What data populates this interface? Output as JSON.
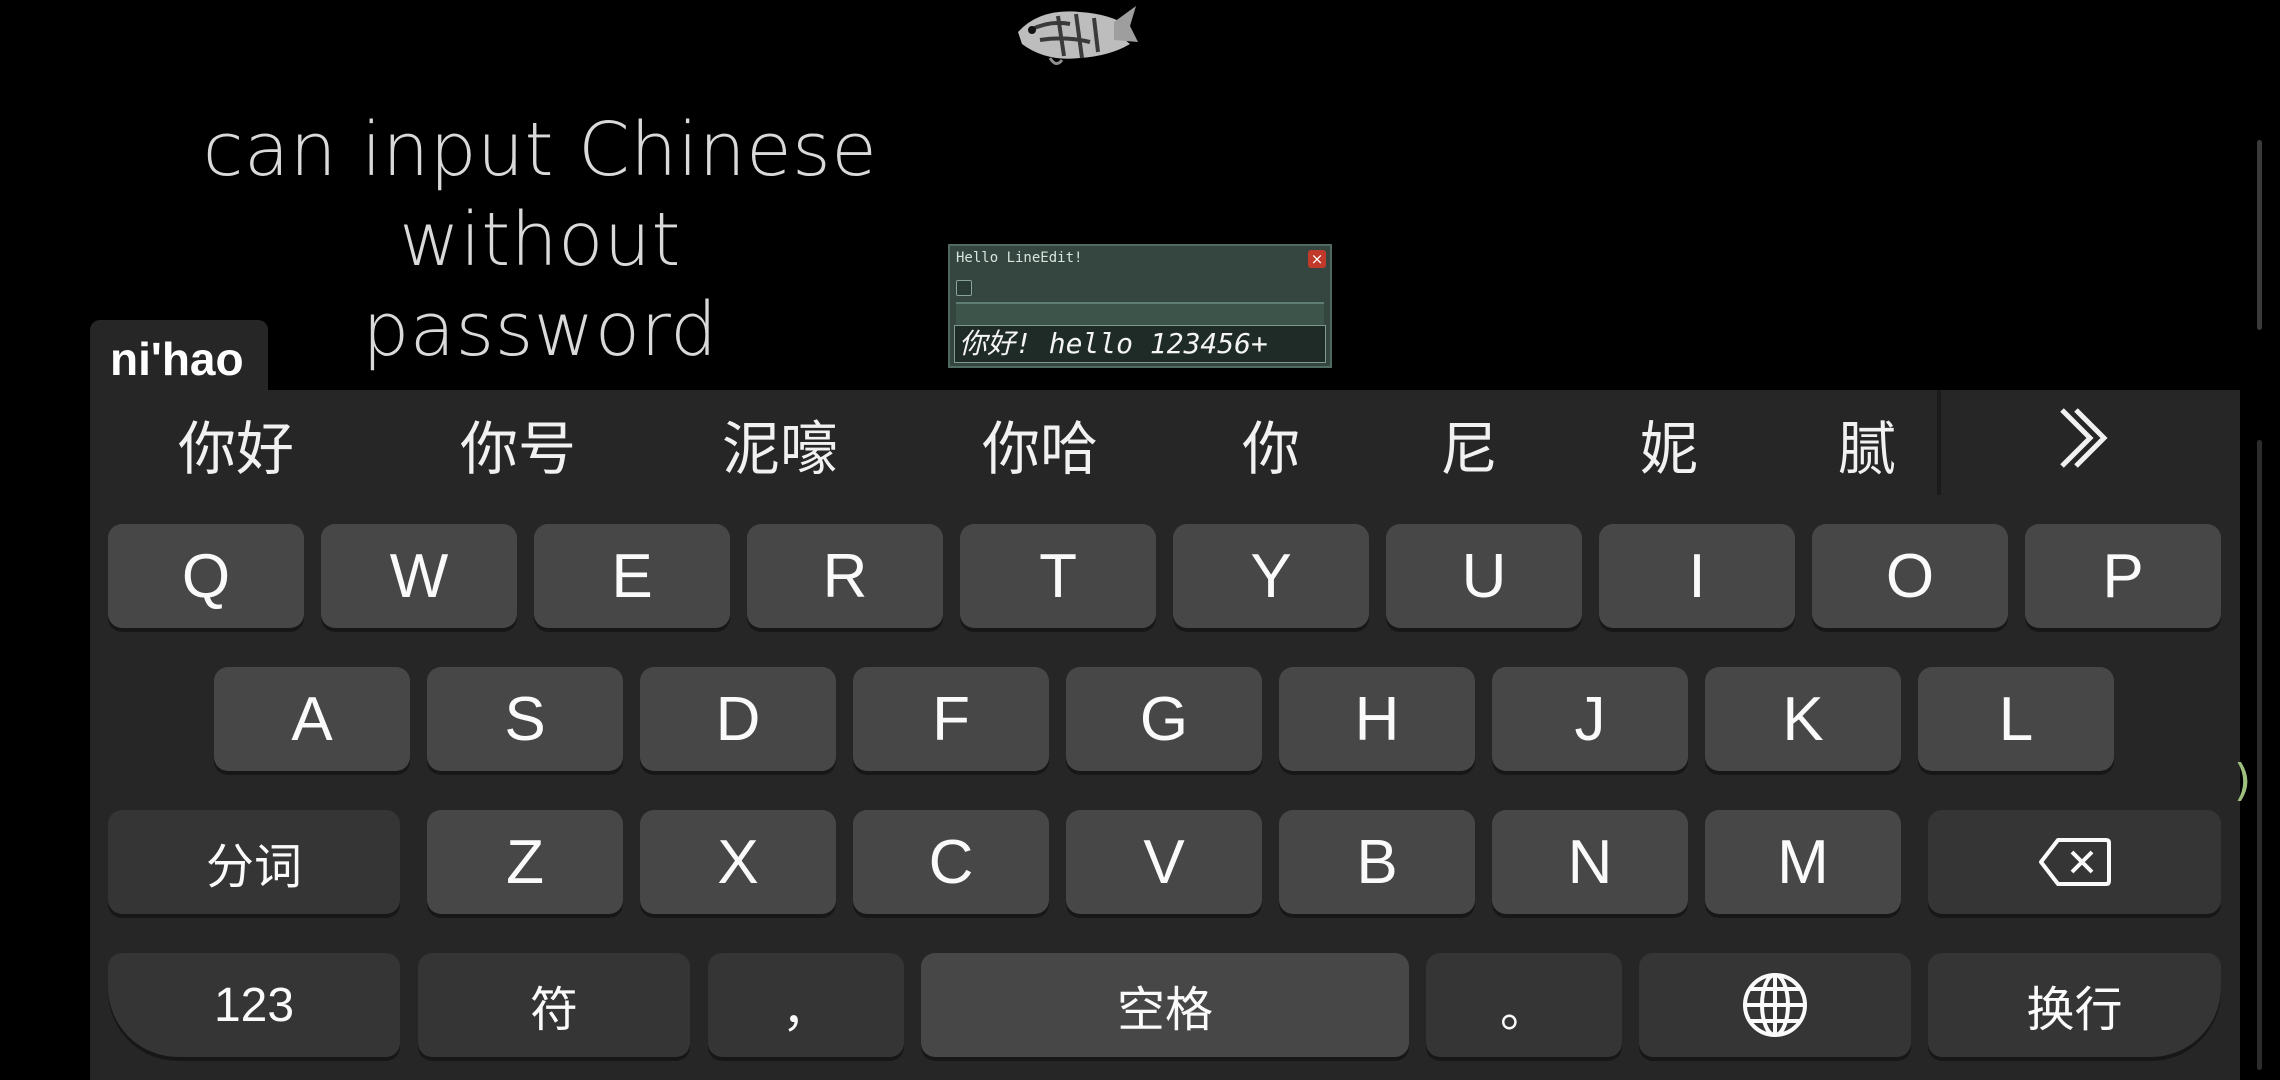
{
  "headline": {
    "line1": "can input Chinese without",
    "line2": "password"
  },
  "dialog": {
    "title": "Hello LineEdit!",
    "close_label": "×",
    "input_value": "你好! hello 123456+"
  },
  "ime": {
    "pinyin": "ni'hao",
    "candidates": [
      "你好",
      "你号",
      "泥嚎",
      "你哈",
      "你",
      "尼",
      "妮",
      "腻"
    ]
  },
  "keyboard": {
    "row1": [
      "Q",
      "W",
      "E",
      "R",
      "T",
      "Y",
      "U",
      "I",
      "O",
      "P"
    ],
    "row2": [
      "A",
      "S",
      "D",
      "F",
      "G",
      "H",
      "J",
      "K",
      "L"
    ],
    "row3_letters": [
      "Z",
      "X",
      "C",
      "V",
      "B",
      "N",
      "M"
    ],
    "segment_label": "分词",
    "numbers_label": "123",
    "symbols_label": "符",
    "comma_label": "，",
    "space_label": "空格",
    "period_label": "。",
    "enter_label": "换行"
  },
  "icons": {
    "fish": "fish-icon",
    "close": "close-icon",
    "more_candidates": "double-chevron-right-icon",
    "backspace": "backspace-icon",
    "language": "globe-icon"
  },
  "colors": {
    "background": "#000000",
    "keyboard_bg": "#262626",
    "key_bg": "#474747",
    "dialog_bg": "#34463f",
    "close_red": "#c0392b"
  }
}
